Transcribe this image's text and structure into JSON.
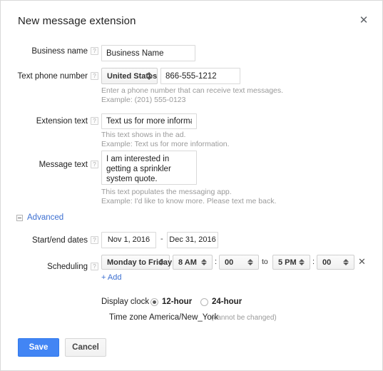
{
  "dialog": {
    "title": "New message extension",
    "close_icon": "close-icon"
  },
  "fields": {
    "business_name": {
      "label": "Business name",
      "help": "?",
      "value": "Business Name"
    },
    "text_phone_number": {
      "label": "Text phone number",
      "help": "?",
      "country": "United States",
      "number": "866-555-1212",
      "hint1": "Enter a phone number that can receive text messages.",
      "hint2": "Example: (201) 555-0123"
    },
    "extension_text": {
      "label": "Extension text",
      "help": "?",
      "value": "Text us for more information.",
      "hint1": "This text shows in the ad.",
      "hint2": "Example: Text us for more information."
    },
    "message_text": {
      "label": "Message text",
      "help": "?",
      "value": "I am interested in getting a sprinkler system quote.",
      "hint1": "This text populates the messaging app.",
      "hint2": "Example: I'd like to know more. Please text me back."
    }
  },
  "advanced": {
    "toggle_label": "Advanced",
    "start_end_dates": {
      "label": "Start/end dates",
      "help": "?",
      "start": "Nov 1, 2016",
      "separator": "-",
      "end": "Dec 31, 2016"
    },
    "scheduling": {
      "label": "Scheduling",
      "help": "?",
      "days": "Monday to Friday",
      "start_hour": "8 AM",
      "start_minute": "00",
      "to": "to",
      "end_hour": "5 PM",
      "end_minute": "00",
      "colon": ":",
      "remove_icon": "close-icon",
      "add_label": "+ Add"
    },
    "display_clock": {
      "label": "Display clock",
      "options": [
        {
          "label": "12-hour",
          "selected": true
        },
        {
          "label": "24-hour",
          "selected": false
        }
      ]
    },
    "time_zone": {
      "label": "Time zone",
      "value": "America/New_York",
      "note": "(cannot be changed)"
    }
  },
  "footer": {
    "save_label": "Save",
    "cancel_label": "Cancel"
  },
  "colors": {
    "primary": "#4285f4",
    "link": "#3c6fd1",
    "border": "#d9d9d9",
    "hint_text": "#9a9a9a"
  }
}
